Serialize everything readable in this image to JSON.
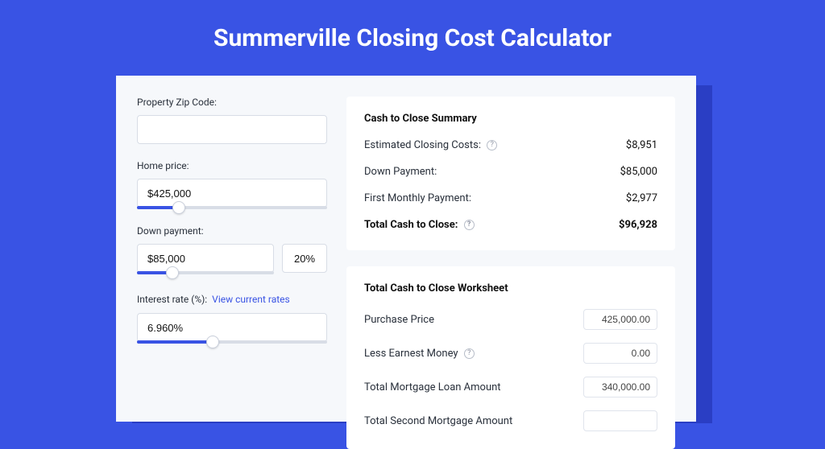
{
  "title": "Summerville Closing Cost Calculator",
  "left": {
    "zip_label": "Property Zip Code:",
    "zip_value": "",
    "home_price_label": "Home price:",
    "home_price_value": "$425,000",
    "home_price_slider_pct": 22,
    "down_payment_label": "Down payment:",
    "down_payment_value": "$85,000",
    "down_payment_pct": "20%",
    "down_payment_slider_pct": 26,
    "interest_label": "Interest rate (%):",
    "interest_link": "View current rates",
    "interest_value": "6.960%",
    "interest_slider_pct": 40
  },
  "summary": {
    "title": "Cash to Close Summary",
    "rows": [
      {
        "label": "Estimated Closing Costs:",
        "help": true,
        "value": "$8,951"
      },
      {
        "label": "Down Payment:",
        "help": false,
        "value": "$85,000"
      },
      {
        "label": "First Monthly Payment:",
        "help": false,
        "value": "$2,977"
      }
    ],
    "total_label": "Total Cash to Close:",
    "total_value": "$96,928"
  },
  "worksheet": {
    "title": "Total Cash to Close Worksheet",
    "rows": [
      {
        "label": "Purchase Price",
        "help": false,
        "value": "425,000.00"
      },
      {
        "label": "Less Earnest Money",
        "help": true,
        "value": "0.00"
      },
      {
        "label": "Total Mortgage Loan Amount",
        "help": false,
        "value": "340,000.00"
      },
      {
        "label": "Total Second Mortgage Amount",
        "help": false,
        "value": ""
      }
    ]
  }
}
